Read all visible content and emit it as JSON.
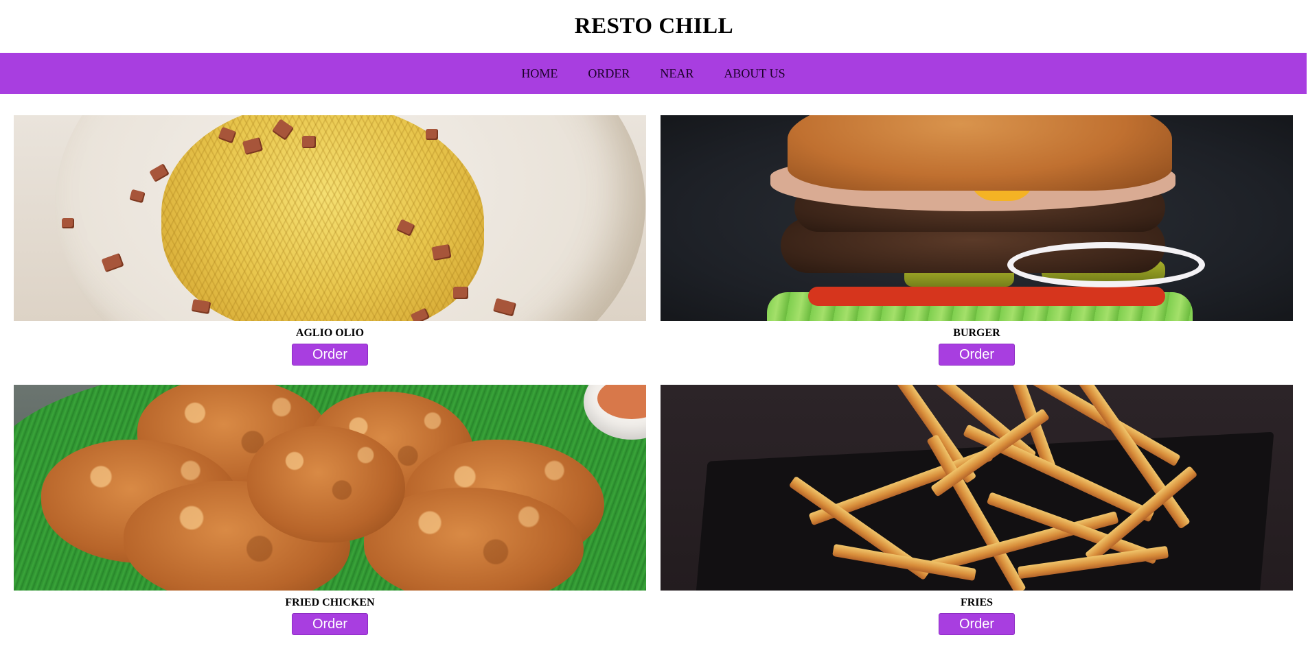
{
  "site": {
    "title": "RESTO CHILL"
  },
  "nav": {
    "items": [
      {
        "label": "HOME"
      },
      {
        "label": "ORDER"
      },
      {
        "label": "NEAR"
      },
      {
        "label": "ABOUT US"
      }
    ]
  },
  "menu": {
    "items": [
      {
        "name": "AGLIO OLIO",
        "button_label": "Order"
      },
      {
        "name": "BURGER",
        "button_label": "Order"
      },
      {
        "name": "FRIED CHICKEN",
        "button_label": "Order"
      },
      {
        "name": "FRIES",
        "button_label": "Order"
      }
    ]
  },
  "colors": {
    "accent": "#a83ee0",
    "background": "#ffffff",
    "text": "#000000"
  }
}
